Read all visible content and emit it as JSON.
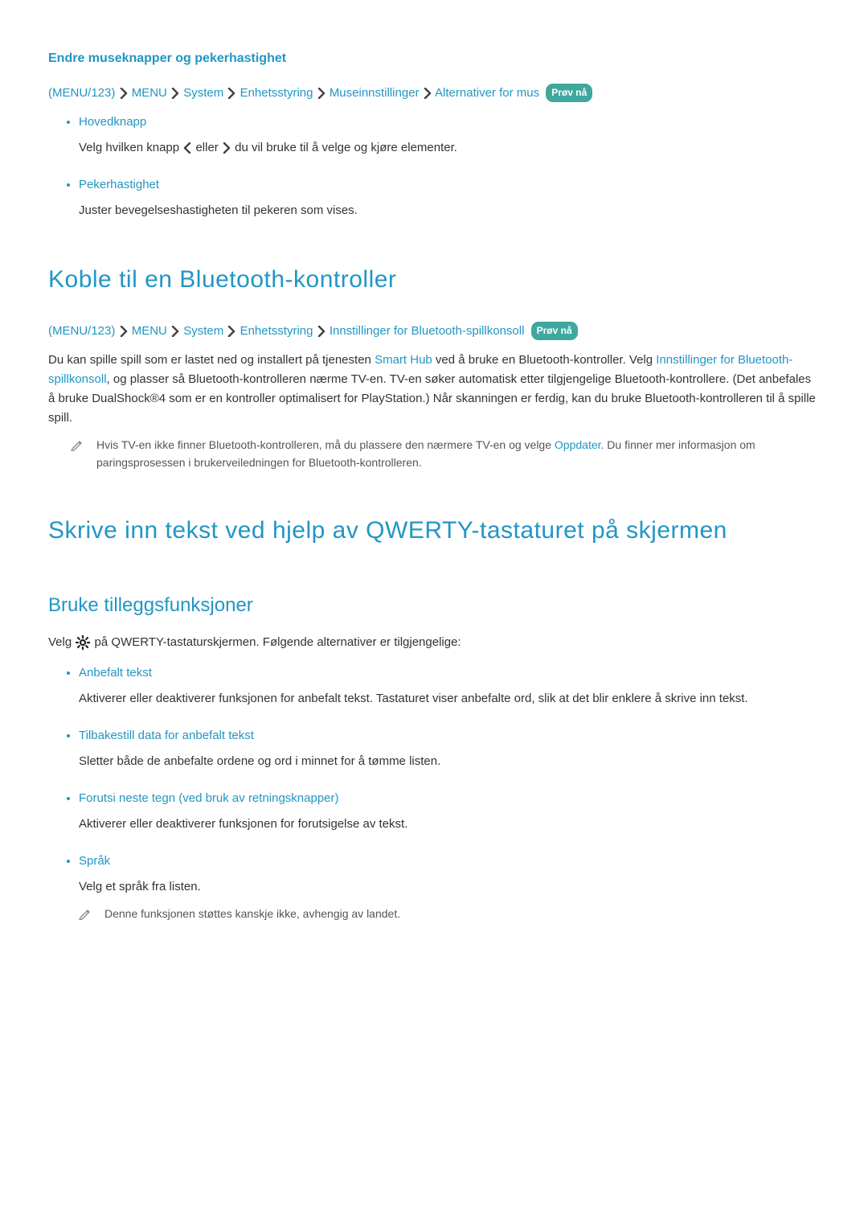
{
  "sec1": {
    "title": "Endre museknapper og pekerhastighet",
    "breadcrumb": {
      "paren_open": "(",
      "item0": "MENU/123",
      "paren_close": ")",
      "item1": "MENU",
      "item2": "System",
      "item3": "Enhetsstyring",
      "item4": "Museinnstillinger",
      "item5": "Alternativer for mus",
      "try": "Prøv nå"
    },
    "opts": [
      {
        "label": "Hovedknapp",
        "desc_before": "Velg hvilken knapp ",
        "desc_mid": " eller ",
        "desc_after": " du vil bruke til å velge og kjøre elementer."
      },
      {
        "label": "Pekerhastighet",
        "desc": "Juster bevegelseshastigheten til pekeren som vises."
      }
    ]
  },
  "sec2": {
    "heading": "Koble til en Bluetooth-kontroller",
    "breadcrumb": {
      "paren_open": "(",
      "item0": "MENU/123",
      "paren_close": ")",
      "item1": "MENU",
      "item2": "System",
      "item3": "Enhetsstyring",
      "item4": "Innstillinger for Bluetooth-spillkonsoll",
      "try": "Prøv nå"
    },
    "para_a": "Du kan spille spill som er lastet ned og installert på tjenesten ",
    "para_link1": "Smart Hub",
    "para_b": " ved å bruke en Bluetooth-kontroller. Velg ",
    "para_link2": "Innstillinger for Bluetooth-spillkonsoll",
    "para_c": ", og plasser så Bluetooth-kontrolleren nærme TV-en. TV-en søker automatisk etter tilgjengelige Bluetooth-kontrollere. (Det anbefales å bruke DualShock®4 som er en kontroller optimalisert for PlayStation.) Når skanningen er ferdig, kan du bruke Bluetooth-kontrolleren til å spille spill.",
    "note_a": "Hvis TV-en ikke finner Bluetooth-kontrolleren, må du plassere den nærmere TV-en og velge ",
    "note_link": "Oppdater",
    "note_b": ". Du finner mer informasjon om paringsprosessen i brukerveiledningen for Bluetooth-kontrolleren."
  },
  "sec3": {
    "heading": "Skrive inn tekst ved hjelp av QWERTY-tastaturet på skjermen",
    "subheading": "Bruke tilleggsfunksjoner",
    "intro_a": "Velg ",
    "intro_b": " på QWERTY-tastaturskjermen. Følgende alternativer er tilgjengelige:",
    "opts": [
      {
        "label": "Anbefalt tekst",
        "desc": "Aktiverer eller deaktiverer funksjonen for anbefalt tekst. Tastaturet viser anbefalte ord, slik at det blir enklere å skrive inn tekst."
      },
      {
        "label": "Tilbakestill data for anbefalt tekst",
        "desc": "Sletter både de anbefalte ordene og ord i minnet for å tømme listen."
      },
      {
        "label": "Forutsi neste tegn (ved bruk av retningsknapper)",
        "desc": "Aktiverer eller deaktiverer funksjonen for forutsigelse av tekst."
      },
      {
        "label": "Språk",
        "desc": "Velg et språk fra listen.",
        "note": "Denne funksjonen støttes kanskje ikke, avhengig av landet."
      }
    ]
  }
}
